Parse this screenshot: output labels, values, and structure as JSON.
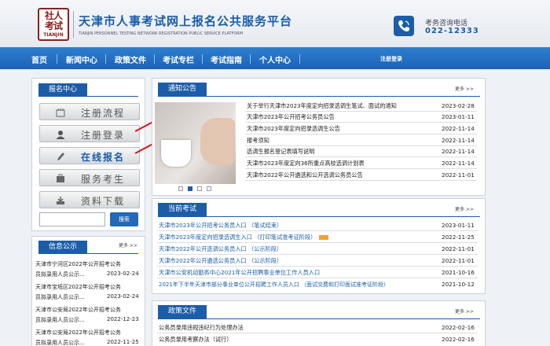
{
  "header": {
    "logo_glyphs": "社人考试",
    "logo_text": "TIANJIN",
    "title": "天津市人事考试网上报名公共服务平台",
    "subtitle": "TIANJIN PERSONNEL TESTING NETWORK REGISTRATION PUBLIC SERVICE PLATFORM",
    "phone_label": "考务咨询电话",
    "phone_number": "022-12333"
  },
  "nav": {
    "items": [
      "首页",
      "新闻中心",
      "政策文件",
      "考试专栏",
      "考试指南",
      "个人中心"
    ],
    "login": "注册登录"
  },
  "sidebar": {
    "tab": "报名中心",
    "buttons": [
      "注册流程",
      "注册登录",
      "在线报名",
      "服务考生",
      "资料下载"
    ],
    "search_placeholder": "",
    "search_button": "搜索"
  },
  "info": {
    "tab": "信息公示",
    "more": "更多 >>",
    "items": [
      {
        "title": "天津市宁河区2022年公开招考公务",
        "date": ""
      },
      {
        "title": "员拟录用人员公示...",
        "date": "2023-02-24"
      },
      {
        "title": "天津市宝坻区2022年公开招考公务",
        "date": ""
      },
      {
        "title": "员拟录用人员公示...",
        "date": "2023-02-24"
      },
      {
        "title": "天津市公安局2022年公开招考公务",
        "date": ""
      },
      {
        "title": "员拟录用人员公示...",
        "date": "2022-12-23"
      },
      {
        "title": "天津市公安局2022年公开招考公务",
        "date": ""
      },
      {
        "title": "员拟录用人员公示...",
        "date": "2022-11-25"
      }
    ]
  },
  "notice": {
    "tab": "通知公告",
    "more": "更多 >>",
    "items": [
      {
        "title": "关于举行天津市2023年度定向招录选调生笔试、面试的通知",
        "date": "2023-02-28"
      },
      {
        "title": "天津市2023年公开招考公务员公告",
        "date": "2023-01-11"
      },
      {
        "title": "天津市2023年度定向招录选调生公告",
        "date": "2022-11-14"
      },
      {
        "title": "报考须知",
        "date": "2022-11-14"
      },
      {
        "title": "选调生报名登记表填写说明",
        "date": "2022-11-14"
      },
      {
        "title": "天津市2023年度定向36所重点高校选调计划表",
        "date": "2022-11-14"
      },
      {
        "title": "天津市2022年公开遴选和公开选调公务员公告",
        "date": "2022-11-01"
      }
    ]
  },
  "exams": {
    "tab": "当前考试",
    "more": "更多 >>",
    "items": [
      {
        "title": "天津市2023年公开招考公务员入口 （笔试结束）",
        "date": "2023-01-11"
      },
      {
        "title": "天津市2023年度定向招录选调生入口 （打印笔试准考证阶段）",
        "date": "2022-11-25"
      },
      {
        "title": "天津市2022年公开选调公务员入口 （公示阶段）",
        "date": "2022-11-01"
      },
      {
        "title": "天津市2022年公开遴选公务员入口 （公示阶段）",
        "date": "2022-11-01"
      },
      {
        "title": "天津市公安机动勤务中心2021年公开招聘事业单位工作人员入口",
        "date": "2021-10-16"
      },
      {
        "title": "2021年下半年天津市部分事业单位公开招聘工作人员入口 （面试交费和打印面试准考证阶段）",
        "date": "2021-10-12"
      }
    ]
  },
  "policy": {
    "tab": "政策文件",
    "more": "更多 >>",
    "items": [
      {
        "title": "公务员录用违规违纪行为处理办法",
        "date": "2022-02-16"
      },
      {
        "title": "公务员录用考察办法（试行）",
        "date": "2022-02-16"
      }
    ]
  },
  "colors": {
    "brand": "#1b5da8",
    "nav": "#1c63b6",
    "arrow": "#d01818"
  }
}
